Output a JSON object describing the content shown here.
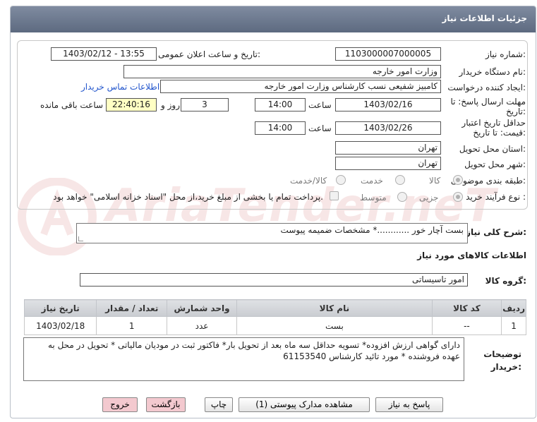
{
  "header": {
    "title": "جزئیات اطلاعات نیاز"
  },
  "form": {
    "need_number_label": "شماره نیاز:",
    "need_number": "1103000007000005",
    "announce_label": "تاریخ و ساعت اعلان عمومی:",
    "announce_value": "1403/02/12 - 13:55",
    "buyer_org_label": "نام دستگاه خریدار:",
    "buyer_org": "وزارت امور خارجه",
    "requester_label": "ایجاد کننده درخواست:",
    "requester": "کامبیز شفیعی نسب کارشناس وزارت امور خارجه",
    "contact_link": "اطلاعات تماس خریدار",
    "deadline_label_1": "مهلت ارسال پاسخ: تا",
    "deadline_label_2": "تاریخ:",
    "deadline_date": "1403/02/16",
    "time_label": "ساعت",
    "deadline_time": "14:00",
    "days_value": "3",
    "days_label": "روز و",
    "remaining_time": "22:40:16",
    "remaining_label": "ساعت باقی مانده",
    "validity_label_1": "حداقل تاریخ اعتبار",
    "validity_label_2": "قیمت: تا تاریخ:",
    "validity_date": "1403/02/26",
    "validity_time_label": "ساعت",
    "validity_time": "14:00",
    "province_label": "استان محل تحویل:",
    "province": "تهران",
    "city_label": "شهر محل تحویل:",
    "city": "تهران",
    "category_label": "طبقه بندی موضوعی:",
    "category_options": [
      "کالا",
      "خدمت",
      "کالا/خدمت"
    ],
    "process_label": "نوع فرآیند خرید :",
    "process_options": [
      "جزیی",
      "متوسط"
    ],
    "payment_note": "پرداخت تمام یا بخشی از مبلغ خرید،از محل \"اسناد خزانه اسلامی\" خواهد بود."
  },
  "summary": {
    "label": "شرح کلی نیاز:",
    "value": "بست آچار خور   ............* مشخصات ضمیمه پیوست"
  },
  "goods_section": {
    "title": "اطلاعات کالاهای مورد نیاز",
    "group_label": "گروه کالا:",
    "group_value": "امور تاسیساتی"
  },
  "table": {
    "headers": [
      "ردیف",
      "کد کالا",
      "نام کالا",
      "واحد شمارش",
      "تعداد / مقدار",
      "تاریخ نیاز"
    ],
    "rows": [
      [
        "1",
        "--",
        "بست",
        "عدد",
        "1",
        "1403/02/18"
      ]
    ]
  },
  "notes": {
    "label_1": "توضیحات",
    "label_2": "خریدار:",
    "value": "دارای گواهی ارزش افزوده* تسویه حداقل سه ماه بعد از تحویل بار* فاکتور ثبت در مودیان  مالیاتی * تحویل در محل به عهده فروشنده * مورد تائید کارشناس 61153540"
  },
  "buttons": {
    "reply": "پاسخ به نیاز",
    "docs": "مشاهده مدارک پیوستی (1)",
    "print": "چاپ",
    "back": "بازگشت",
    "exit": "خروج"
  },
  "colors": {
    "header_bg": "#6b778c",
    "link": "#2255cc",
    "highlight_field": "#ffffc4",
    "pink_button": "#f3c9cf"
  }
}
